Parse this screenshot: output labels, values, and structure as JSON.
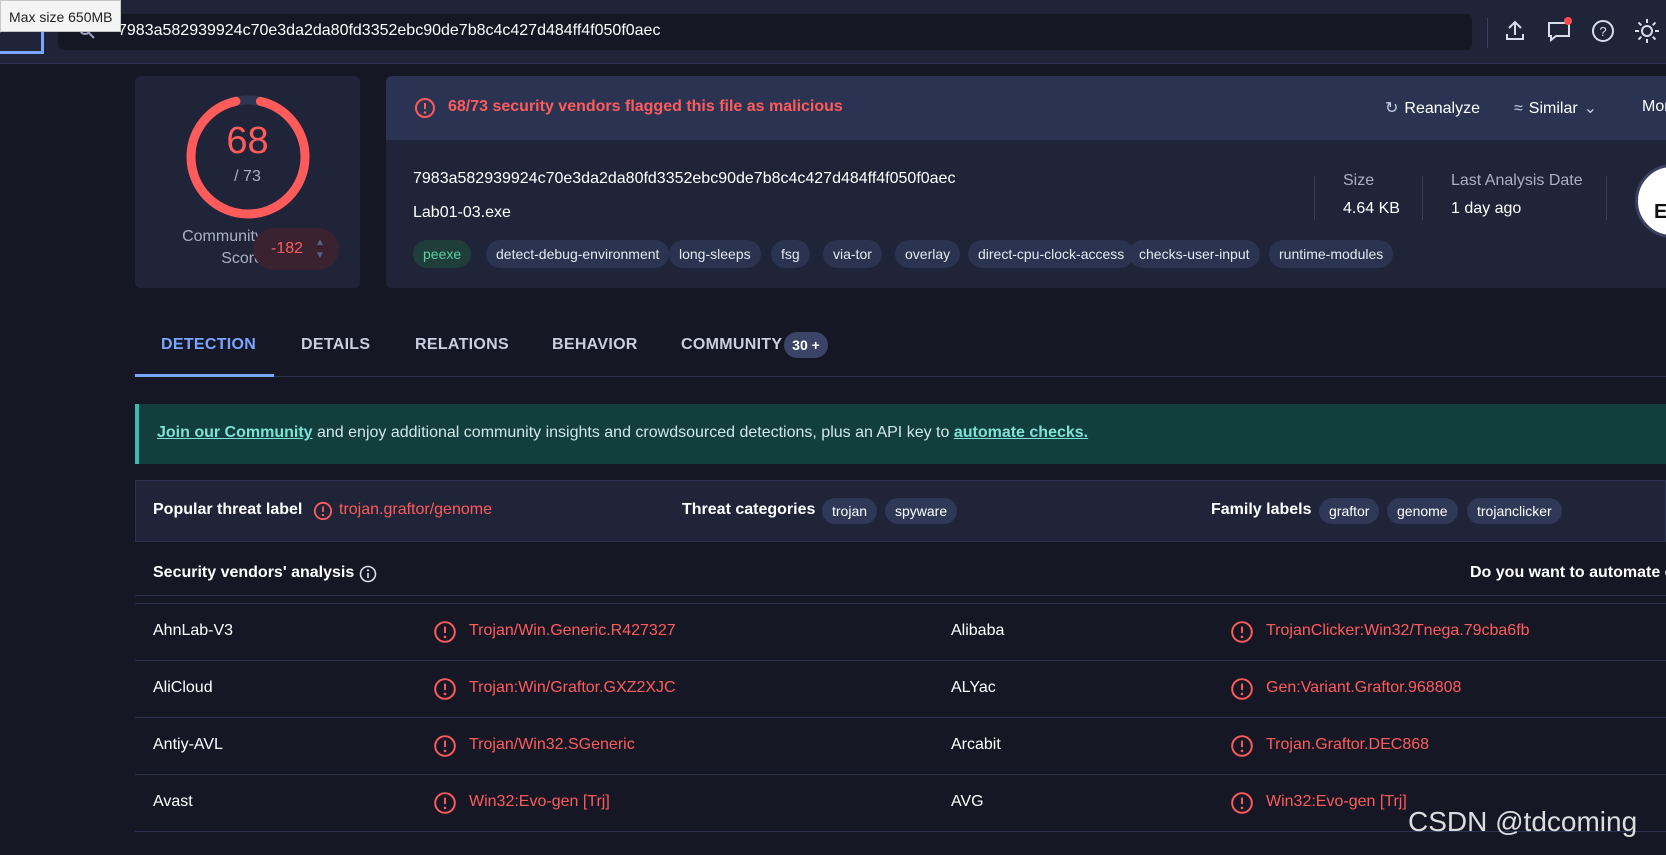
{
  "tooltip": "Max size 650MB",
  "search": {
    "query": "7983a582939924c70e3da2da80fd3352ebc90de7b8c4c427d484ff4f050f0aec"
  },
  "score": {
    "detections": "68",
    "total": "/ 73",
    "community_label_line1": "Community",
    "community_label_line2": "Score",
    "community_value": "-182",
    "ring_fraction": 0.93
  },
  "header": {
    "alert": "68/73 security vendors flagged this file as malicious",
    "reanalyze": "Reanalyze",
    "similar": "Similar",
    "more": "Mor"
  },
  "file": {
    "hash": "7983a582939924c70e3da2da80fd3352ebc90de7b8c4c427d484ff4f050f0aec",
    "name": "Lab01-03.exe",
    "tags": [
      "peexe",
      "detect-debug-environment",
      "long-sleeps",
      "fsg",
      "via-tor",
      "overlay",
      "direct-cpu-clock-access",
      "checks-user-input",
      "runtime-modules"
    ],
    "size_label": "Size",
    "size_value": "4.64 KB",
    "date_label": "Last Analysis Date",
    "date_value": "1 day ago",
    "type_badge": "EX"
  },
  "tabs": [
    "DETECTION",
    "DETAILS",
    "RELATIONS",
    "BEHAVIOR",
    "COMMUNITY"
  ],
  "tab_badge": "30 +",
  "banner": {
    "link1": "Join our Community",
    "middle": " and enjoy additional community insights and crowdsourced detections, plus an API key to ",
    "link2": "automate checks."
  },
  "threat": {
    "popular_label": "Popular threat label",
    "popular_value": "trojan.graftor/genome",
    "categories_label": "Threat categories",
    "categories": [
      "trojan",
      "spyware"
    ],
    "family_label": "Family labels",
    "families": [
      "graftor",
      "genome",
      "trojanclicker"
    ]
  },
  "vendors": {
    "title": "Security vendors' analysis",
    "right_text": "Do you want to automate c",
    "rows": [
      {
        "left_name": "AhnLab-V3",
        "left_result": "Trojan/Win.Generic.R427327",
        "right_name": "Alibaba",
        "right_result": "TrojanClicker:Win32/Tnega.79cba6fb"
      },
      {
        "left_name": "AliCloud",
        "left_result": "Trojan:Win/Graftor.GXZ2XJC",
        "right_name": "ALYac",
        "right_result": "Gen:Variant.Graftor.968808"
      },
      {
        "left_name": "Antiy-AVL",
        "left_result": "Trojan/Win32.SGeneric",
        "right_name": "Arcabit",
        "right_result": "Trojan.Graftor.DEC868"
      },
      {
        "left_name": "Avast",
        "left_result": "Win32:Evo-gen [Trj]",
        "right_name": "AVG",
        "right_result": "Win32:Evo-gen [Trj]"
      }
    ]
  },
  "watermark": "CSDN @tdcoming",
  "colors": {
    "accent": "#7aa6ff",
    "malicious": "#ff5b5b",
    "background": "#151725",
    "card": "#1f2438"
  }
}
